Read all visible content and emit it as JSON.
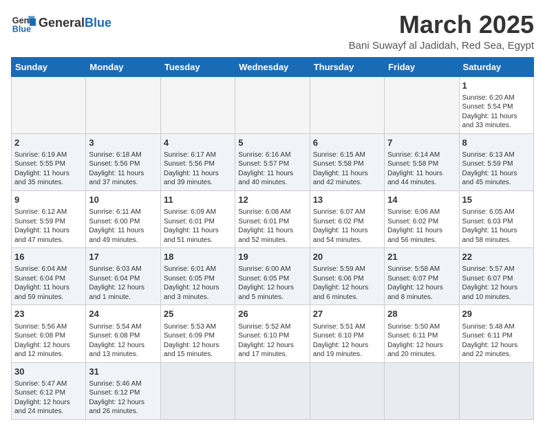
{
  "header": {
    "logo_general": "General",
    "logo_blue": "Blue",
    "month_title": "March 2025",
    "location": "Bani Suwayf al Jadidah, Red Sea, Egypt"
  },
  "days_of_week": [
    "Sunday",
    "Monday",
    "Tuesday",
    "Wednesday",
    "Thursday",
    "Friday",
    "Saturday"
  ],
  "weeks": [
    [
      {
        "day": "",
        "info": ""
      },
      {
        "day": "",
        "info": ""
      },
      {
        "day": "",
        "info": ""
      },
      {
        "day": "",
        "info": ""
      },
      {
        "day": "",
        "info": ""
      },
      {
        "day": "",
        "info": ""
      },
      {
        "day": "1",
        "info": "Sunrise: 6:20 AM\nSunset: 5:54 PM\nDaylight: 11 hours\nand 33 minutes."
      }
    ],
    [
      {
        "day": "2",
        "info": "Sunrise: 6:19 AM\nSunset: 5:55 PM\nDaylight: 11 hours\nand 35 minutes."
      },
      {
        "day": "3",
        "info": "Sunrise: 6:18 AM\nSunset: 5:56 PM\nDaylight: 11 hours\nand 37 minutes."
      },
      {
        "day": "4",
        "info": "Sunrise: 6:17 AM\nSunset: 5:56 PM\nDaylight: 11 hours\nand 39 minutes."
      },
      {
        "day": "5",
        "info": "Sunrise: 6:16 AM\nSunset: 5:57 PM\nDaylight: 11 hours\nand 40 minutes."
      },
      {
        "day": "6",
        "info": "Sunrise: 6:15 AM\nSunset: 5:58 PM\nDaylight: 11 hours\nand 42 minutes."
      },
      {
        "day": "7",
        "info": "Sunrise: 6:14 AM\nSunset: 5:58 PM\nDaylight: 11 hours\nand 44 minutes."
      },
      {
        "day": "8",
        "info": "Sunrise: 6:13 AM\nSunset: 5:59 PM\nDaylight: 11 hours\nand 45 minutes."
      }
    ],
    [
      {
        "day": "9",
        "info": "Sunrise: 6:12 AM\nSunset: 5:59 PM\nDaylight: 11 hours\nand 47 minutes."
      },
      {
        "day": "10",
        "info": "Sunrise: 6:11 AM\nSunset: 6:00 PM\nDaylight: 11 hours\nand 49 minutes."
      },
      {
        "day": "11",
        "info": "Sunrise: 6:09 AM\nSunset: 6:01 PM\nDaylight: 11 hours\nand 51 minutes."
      },
      {
        "day": "12",
        "info": "Sunrise: 6:08 AM\nSunset: 6:01 PM\nDaylight: 11 hours\nand 52 minutes."
      },
      {
        "day": "13",
        "info": "Sunrise: 6:07 AM\nSunset: 6:02 PM\nDaylight: 11 hours\nand 54 minutes."
      },
      {
        "day": "14",
        "info": "Sunrise: 6:06 AM\nSunset: 6:02 PM\nDaylight: 11 hours\nand 56 minutes."
      },
      {
        "day": "15",
        "info": "Sunrise: 6:05 AM\nSunset: 6:03 PM\nDaylight: 11 hours\nand 58 minutes."
      }
    ],
    [
      {
        "day": "16",
        "info": "Sunrise: 6:04 AM\nSunset: 6:04 PM\nDaylight: 11 hours\nand 59 minutes."
      },
      {
        "day": "17",
        "info": "Sunrise: 6:03 AM\nSunset: 6:04 PM\nDaylight: 12 hours\nand 1 minute."
      },
      {
        "day": "18",
        "info": "Sunrise: 6:01 AM\nSunset: 6:05 PM\nDaylight: 12 hours\nand 3 minutes."
      },
      {
        "day": "19",
        "info": "Sunrise: 6:00 AM\nSunset: 6:05 PM\nDaylight: 12 hours\nand 5 minutes."
      },
      {
        "day": "20",
        "info": "Sunrise: 5:59 AM\nSunset: 6:06 PM\nDaylight: 12 hours\nand 6 minutes."
      },
      {
        "day": "21",
        "info": "Sunrise: 5:58 AM\nSunset: 6:07 PM\nDaylight: 12 hours\nand 8 minutes."
      },
      {
        "day": "22",
        "info": "Sunrise: 5:57 AM\nSunset: 6:07 PM\nDaylight: 12 hours\nand 10 minutes."
      }
    ],
    [
      {
        "day": "23",
        "info": "Sunrise: 5:56 AM\nSunset: 6:08 PM\nDaylight: 12 hours\nand 12 minutes."
      },
      {
        "day": "24",
        "info": "Sunrise: 5:54 AM\nSunset: 6:08 PM\nDaylight: 12 hours\nand 13 minutes."
      },
      {
        "day": "25",
        "info": "Sunrise: 5:53 AM\nSunset: 6:09 PM\nDaylight: 12 hours\nand 15 minutes."
      },
      {
        "day": "26",
        "info": "Sunrise: 5:52 AM\nSunset: 6:10 PM\nDaylight: 12 hours\nand 17 minutes."
      },
      {
        "day": "27",
        "info": "Sunrise: 5:51 AM\nSunset: 6:10 PM\nDaylight: 12 hours\nand 19 minutes."
      },
      {
        "day": "28",
        "info": "Sunrise: 5:50 AM\nSunset: 6:11 PM\nDaylight: 12 hours\nand 20 minutes."
      },
      {
        "day": "29",
        "info": "Sunrise: 5:48 AM\nSunset: 6:11 PM\nDaylight: 12 hours\nand 22 minutes."
      }
    ],
    [
      {
        "day": "30",
        "info": "Sunrise: 5:47 AM\nSunset: 6:12 PM\nDaylight: 12 hours\nand 24 minutes."
      },
      {
        "day": "31",
        "info": "Sunrise: 5:46 AM\nSunset: 6:12 PM\nDaylight: 12 hours\nand 26 minutes."
      },
      {
        "day": "",
        "info": ""
      },
      {
        "day": "",
        "info": ""
      },
      {
        "day": "",
        "info": ""
      },
      {
        "day": "",
        "info": ""
      },
      {
        "day": "",
        "info": ""
      }
    ]
  ]
}
